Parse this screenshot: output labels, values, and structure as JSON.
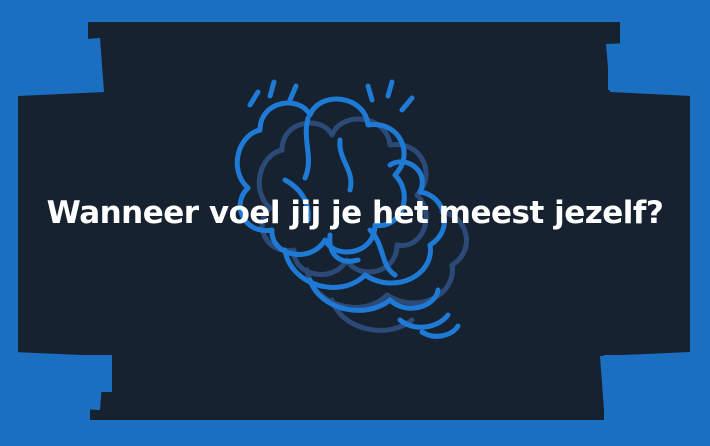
{
  "slide": {
    "question": "Wanneer voel jij je het meest jezelf?",
    "illustration": "brain-icon"
  },
  "colors": {
    "frame": "#1b6fc0",
    "background": "#16222f",
    "illustration_primary": "#1f7ad6",
    "illustration_shadow": "#2c4a78",
    "text": "#ffffff"
  }
}
